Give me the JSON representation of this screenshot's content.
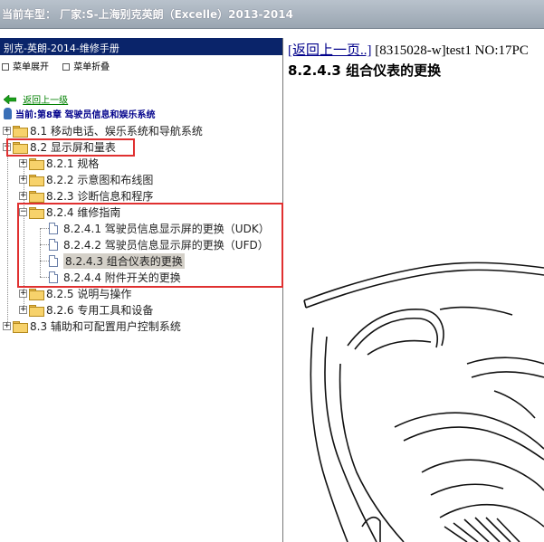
{
  "window": {
    "title": "当前车型：  厂家:S-上海别克英朗（Excelle）2013-2014"
  },
  "left_panel": {
    "header": "别克-英朗-2014-维修手册",
    "expand_all": "菜单展开",
    "collapse_all": "菜单折叠",
    "back_link": "返回上一级",
    "current_label": "当前:第8章 驾驶员信息和娱乐系统"
  },
  "tree": {
    "n81": "8.1 移动电话、娱乐系统和导航系统",
    "n82": "8.2 显示屏和量表",
    "n821": "8.2.1 规格",
    "n822": "8.2.2 示意图和布线图",
    "n823": "8.2.3 诊断信息和程序",
    "n824": "8.2.4 维修指南",
    "n8241": "8.2.4.1 驾驶员信息显示屏的更换（UDK）",
    "n8242": "8.2.4.2 驾驶员信息显示屏的更换（UFD）",
    "n8243": "8.2.4.3 组合仪表的更换",
    "n8244": "8.2.4.4 附件开关的更换",
    "n825": "8.2.5 说明与操作",
    "n826": "8.2.6 专用工具和设备",
    "n83": "8.3 辅助和可配置用户控制系统"
  },
  "content": {
    "back_link": "[返回上一页..]",
    "doc_id": " [8315028-w]test1 NO:17PC",
    "section_title": "8.2.4.3 组合仪表的更换"
  },
  "colors": {
    "header_bg": "#0a246a",
    "highlight_box": "#e03030",
    "link": "#008000"
  },
  "icons": [
    "back-arrow-icon",
    "current-location-icon",
    "folder-icon",
    "document-icon",
    "plus-icon",
    "minus-icon"
  ]
}
